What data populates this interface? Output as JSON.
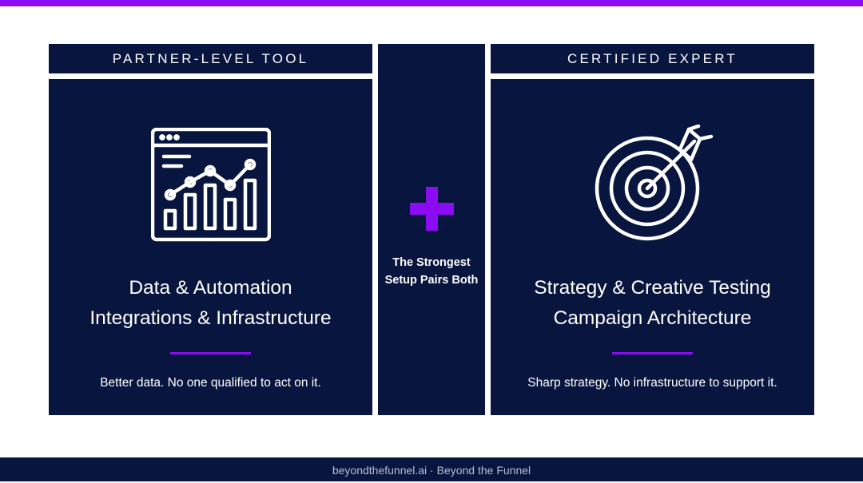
{
  "left": {
    "header": "PARTNER-LEVEL TOOL",
    "title_line1": "Data & Automation",
    "title_line2": "Integrations & Infrastructure",
    "subtitle": "Better data. No one qualified to act on it.",
    "icon": "analytics-dashboard-icon"
  },
  "middle": {
    "icon": "plus-icon",
    "line1": "The Strongest",
    "line2": "Setup Pairs Both"
  },
  "right": {
    "header": "CERTIFIED EXPERT",
    "title_line1": "Strategy & Creative Testing",
    "title_line2": "Campaign Architecture",
    "subtitle": "Sharp strategy. No infrastructure to support it.",
    "icon": "target-arrow-icon"
  },
  "footer": {
    "text": "beyondthefunnel.ai · Beyond the Funnel"
  },
  "colors": {
    "accent": "#8b0bf2",
    "panel": "#08153f",
    "background": "#ffffff",
    "text": "#ffffff",
    "footer_text": "#b9bfd4"
  }
}
